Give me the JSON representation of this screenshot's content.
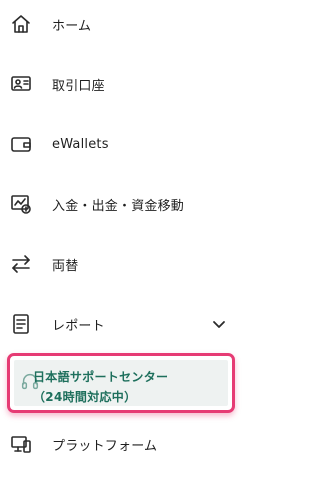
{
  "menu": {
    "home": "ホーム",
    "trading_account": "取引口座",
    "ewallets": "eWallets",
    "deposit_withdraw": "入金・出金・資金移動",
    "exchange": "両替",
    "reports": "レポート",
    "support_line1": "日本語サポートセンター",
    "support_line2": "（24時間対応中）",
    "platform": "プラットフォーム"
  },
  "colors": {
    "highlight_border": "#e63b74",
    "support_text": "#1d6f5c"
  },
  "icons": [
    "home-icon",
    "account-card-icon",
    "wallet-icon",
    "deposit-withdraw-icon",
    "exchange-arrows-icon",
    "report-document-icon",
    "chevron-down-icon",
    "support-headset-icon",
    "devices-icon"
  ]
}
